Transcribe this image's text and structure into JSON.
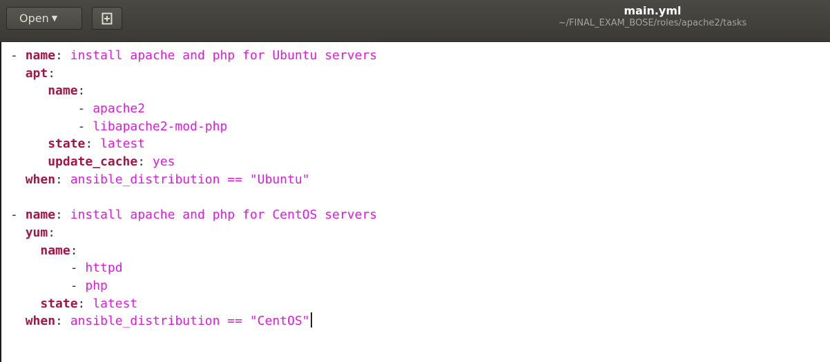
{
  "header": {
    "open_label": "Open",
    "open_caret_icon": "caret-down-icon",
    "new_tab_icon": "new-document-icon",
    "title": "main.yml",
    "path": "~/FINAL_EXAM_BOSE/roles/apache2/tasks"
  },
  "colors": {
    "keyword": "#a31546",
    "value": "#dd19dd",
    "header_bg": "#3b3a36"
  },
  "editor": {
    "lines": [
      [
        {
          "t": "- ",
          "c": "p"
        },
        {
          "t": "name",
          "c": "k"
        },
        {
          "t": ": ",
          "c": "p"
        },
        {
          "t": "install apache and php for Ubuntu servers",
          "c": "v"
        }
      ],
      [
        {
          "t": "  ",
          "c": "p"
        },
        {
          "t": "apt",
          "c": "k"
        },
        {
          "t": ":",
          "c": "p"
        }
      ],
      [
        {
          "t": "     ",
          "c": "p"
        },
        {
          "t": "name",
          "c": "k"
        },
        {
          "t": ":",
          "c": "p"
        }
      ],
      [
        {
          "t": "         - ",
          "c": "p"
        },
        {
          "t": "apache2",
          "c": "v"
        }
      ],
      [
        {
          "t": "         - ",
          "c": "p"
        },
        {
          "t": "libapache2-mod-php",
          "c": "v"
        }
      ],
      [
        {
          "t": "     ",
          "c": "p"
        },
        {
          "t": "state",
          "c": "k"
        },
        {
          "t": ": ",
          "c": "p"
        },
        {
          "t": "latest",
          "c": "v"
        }
      ],
      [
        {
          "t": "     ",
          "c": "p"
        },
        {
          "t": "update_cache",
          "c": "k"
        },
        {
          "t": ": ",
          "c": "p"
        },
        {
          "t": "yes",
          "c": "v"
        }
      ],
      [
        {
          "t": "  ",
          "c": "p"
        },
        {
          "t": "when",
          "c": "k"
        },
        {
          "t": ": ",
          "c": "p"
        },
        {
          "t": "ansible_distribution == \"Ubuntu\"",
          "c": "v"
        }
      ],
      [],
      [
        {
          "t": "- ",
          "c": "p"
        },
        {
          "t": "name",
          "c": "k"
        },
        {
          "t": ": ",
          "c": "p"
        },
        {
          "t": "install apache and php for CentOS servers",
          "c": "v"
        }
      ],
      [
        {
          "t": "  ",
          "c": "p"
        },
        {
          "t": "yum",
          "c": "k"
        },
        {
          "t": ":",
          "c": "p"
        }
      ],
      [
        {
          "t": "    ",
          "c": "p"
        },
        {
          "t": "name",
          "c": "k"
        },
        {
          "t": ":",
          "c": "p"
        }
      ],
      [
        {
          "t": "        - ",
          "c": "p"
        },
        {
          "t": "httpd",
          "c": "v"
        }
      ],
      [
        {
          "t": "        - ",
          "c": "p"
        },
        {
          "t": "php",
          "c": "v"
        }
      ],
      [
        {
          "t": "    ",
          "c": "p"
        },
        {
          "t": "state",
          "c": "k"
        },
        {
          "t": ": ",
          "c": "p"
        },
        {
          "t": "latest",
          "c": "v"
        }
      ],
      [
        {
          "t": "  ",
          "c": "p"
        },
        {
          "t": "when",
          "c": "k"
        },
        {
          "t": ": ",
          "c": "p"
        },
        {
          "t": "ansible_distribution == \"CentOS\"",
          "c": "v"
        }
      ]
    ],
    "cursor_line": 15
  }
}
